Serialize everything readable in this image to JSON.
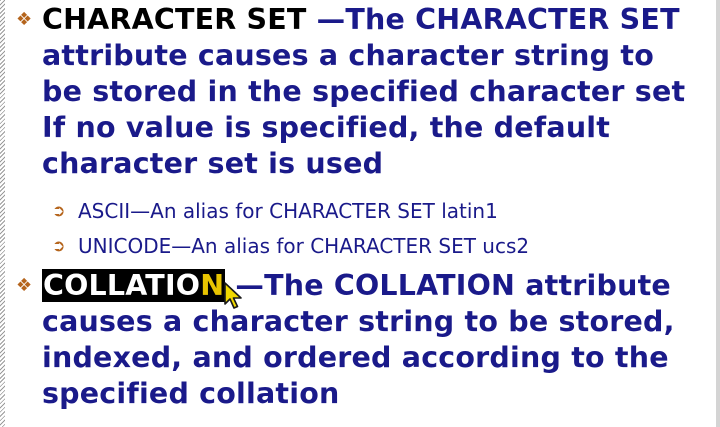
{
  "slide": {
    "items": [
      {
        "term": "CHARACTER SET",
        "text": " —The CHARACTER SET attribute causes a character string to be stored in the specified character set If no value is specified, the default character set is used"
      },
      {
        "term_main": "COLLATIO",
        "term_last": "N",
        "text": " —The COLLATION attribute causes a character string to be stored, indexed, and ordered according to the specified collation"
      }
    ],
    "subitems": [
      "ASCII—An alias for CHARACTER SET latin1",
      "UNICODE—An alias for CHARACTER SET ucs2"
    ]
  },
  "icons": {
    "bullet": "diamond-bullet-icon",
    "subbullet": "arrow-bullet-icon",
    "cursor": "mouse-pointer-icon"
  },
  "colors": {
    "text": "#1a1a8a",
    "term": "#000000",
    "bullet": "#b5651d",
    "highlight_bg": "#000000",
    "highlight_fg": "#ffffff",
    "cursor_fill": "#f0d800"
  }
}
